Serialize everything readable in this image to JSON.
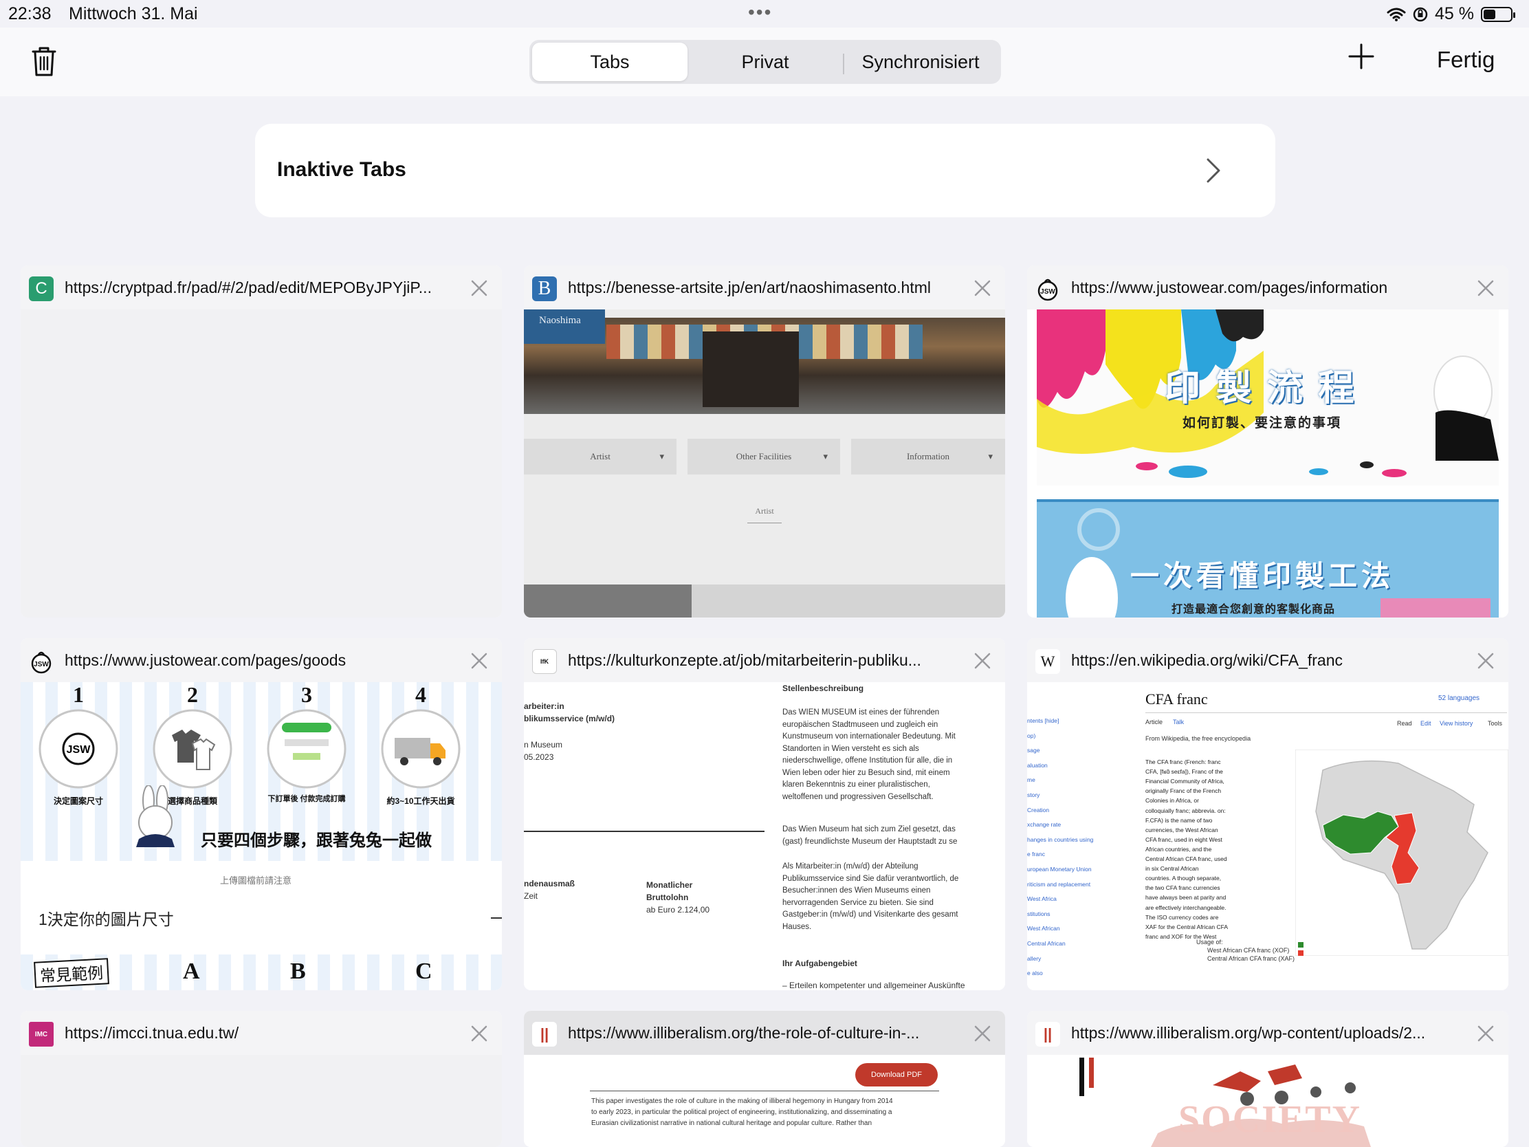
{
  "status": {
    "time": "22:38",
    "date": "Mittwoch 31. Mai",
    "battery": "45 %",
    "battery_level": 0.45
  },
  "toolbar": {
    "segments": [
      "Tabs",
      "Privat",
      "Synchronisiert"
    ],
    "active_segment": 0,
    "done_label": "Fertig"
  },
  "inactive_tabs": {
    "label": "Inaktive Tabs"
  },
  "tabs": [
    {
      "url": "https://cryptpad.fr/pad/#/2/pad/edit/MEPOByJPYjiP...",
      "favicon_text": "C"
    },
    {
      "url": "https://benesse-artsite.jp/en/art/naoshimasento.html",
      "favicon_text": "B",
      "preview": {
        "banner": "Naoshima",
        "menu": [
          "Artist",
          "Other Facilities",
          "Information"
        ],
        "subtitle": "Artist"
      }
    },
    {
      "url": "https://www.justowear.com/pages/information",
      "favicon_text": "JSW",
      "preview": {
        "heading1": "印 製 流 程",
        "sub1": "如何訂製、要注意的事項",
        "heading2": "一次看懂印製工法",
        "sub2": "打造最適合您創意的客製化商品"
      }
    },
    {
      "url": "https://www.justowear.com/pages/goods",
      "favicon_text": "JSW",
      "preview": {
        "steps": [
          {
            "num": "1",
            "label": "決定圖案尺寸"
          },
          {
            "num": "2",
            "label": "選擇商品種類"
          },
          {
            "num": "3",
            "label": "下訂單後 付款完成訂購"
          },
          {
            "num": "4",
            "label": "約3~10工作天出貨"
          }
        ],
        "slogan": "只要四個步驟，跟著兔兔一起做",
        "caption": "上傳圖檔前請注意",
        "step_title": "1決定你的圖片尺寸",
        "examples_label": "常見範例",
        "example_letters": [
          "A",
          "B",
          "C"
        ]
      }
    },
    {
      "url": "https://kulturkonzepte.at/job/mitarbeiterin-publiku...",
      "favicon_text": "IfK",
      "preview": {
        "left_lines": [
          "arbeiter:in",
          "blikumsservice (m/w/d)",
          "",
          "n Museum",
          "05.2023"
        ],
        "left_bottom": [
          "ndenausmaß",
          "Zeit"
        ],
        "salary_label": [
          "Monatlicher",
          "Bruttolohn"
        ],
        "salary_value": "ab Euro 2.124,00",
        "heading": "Stellenbeschreibung",
        "para1": [
          "Das WIEN MUSEUM ist eines der führenden",
          "europäischen Stadtmuseen und zugleich ein",
          "Kunstmuseum von internationaler Bedeutung. Mit",
          "Standorten in Wien versteht es sich als",
          "niederschwellige, offene Institution für alle, die in",
          "Wien leben oder hier zu Besuch sind, mit einem",
          "klaren Bekenntnis zu einer pluralistischen,",
          "weltoffenen und progressiven Gesellschaft."
        ],
        "para2": [
          "Das Wien Museum hat sich zum Ziel gesetzt, das",
          "(gast) freundlichste Museum der Hauptstadt zu se"
        ],
        "para3": [
          "Als Mitarbeiter:in (m/w/d) der Abteilung",
          "Publikumsservice sind Sie dafür verantwortlich, de",
          "Besucher:innen des Wien Museums einen",
          "hervorragenden Service zu bieten. Sie sind",
          "Gastgeber:in (m/w/d) und Visitenkarte des gesamt",
          "Hauses."
        ],
        "heading2": "Ihr Aufgabengebiet",
        "bullet": "– Erteilen kompetenter und allgemeiner Auskünfte"
      }
    },
    {
      "url": "https://en.wikipedia.org/wiki/CFA_franc",
      "favicon_text": "W",
      "preview": {
        "title": "CFA franc",
        "languages": "52 languages",
        "tabs": [
          "Article",
          "Talk"
        ],
        "actions": [
          "Read",
          "Edit",
          "View history",
          "Tools"
        ],
        "from": "From Wikipedia, the free encyclopedia",
        "sidebar": [
          "ntents [hide]",
          "op)",
          "sage",
          "aluation",
          "me",
          "story",
          "Creation",
          "xchange rate",
          "hanges in countries using",
          "e franc",
          "uropean Monetary Union",
          "riticism and replacement",
          "West Africa",
          "stitutions",
          "West African",
          "Central African",
          "allery",
          "e also"
        ],
        "body": [
          "The CFA franc (French: franc",
          "CFA, [fʁɑ̃ seɛfa]), Franc of the",
          "Financial Community of Africa,",
          "originally Franc of the French",
          "Colonies in Africa, or",
          "colloquially franc; abbrevia. on:",
          "F.CFA) is the name of two",
          "currencies, the West African",
          "CFA franc, used in eight West",
          "African countries, and the",
          "Central African CFA franc, used",
          "in six Central African",
          "countries. A though separate,",
          "the two CFA franc currencies",
          "have always been at parity and",
          "are effectively interchangeable.",
          "The ISO currency codes are",
          "XAF for the Central African CFA",
          "franc and XOF for the West"
        ],
        "legend_title": "Usage of:",
        "legend": [
          "West African CFA franc (XOF)",
          "Central African CFA franc (XAF)"
        ]
      }
    },
    {
      "url": "https://imcci.tnua.edu.tw/",
      "favicon_text": "IMC"
    },
    {
      "url": "https://www.illiberalism.org/the-role-of-culture-in-...",
      "favicon_text": "||",
      "preview": {
        "button": "Download PDF",
        "lines": [
          "This paper investigates the role of culture in the making of illiberal hegemony in Hungary from 2014",
          "to early 2023, in particular the political project of engineering, institutionalizing, and disseminating a",
          "Eurasian civilizationist narrative in national cultural heritage and popular culture. Rather than"
        ]
      }
    },
    {
      "url": "https://www.illiberalism.org/wp-content/uploads/2...",
      "favicon_text": "||",
      "preview": {
        "art_text": "SOCIETY"
      }
    }
  ],
  "colors": {
    "background": "#f2f2f7",
    "card_header": "#f4f4f6",
    "wiki_green": "#2e8b2e",
    "wiki_red": "#e53a2e",
    "pdf_button": "#c0392b"
  }
}
